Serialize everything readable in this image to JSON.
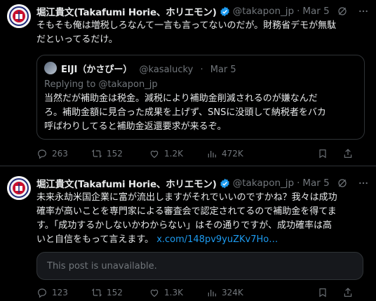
{
  "tweets": [
    {
      "author_name": "堀江貴文(Takafumi Horie、ホリエモン)",
      "handle": "@takapon_jp",
      "date": "Mar 5",
      "text": "そもそも俺は増税しろなんて一言も言ってないのだが。財務省デモが無駄\nだといってるだけ。",
      "quote": {
        "author_name": "EIJI（かさぴー）",
        "handle": "@kasalucky",
        "date": "Mar 5",
        "reply_prefix": "Replying to",
        "reply_to": "@takapon_jp",
        "text": "当然だが補助金は税金。減税により補助金削減されるのが嫌なんだ\nろ。補助金額に見合った成果を上げず、SNSに没頭して納税者をバカ\n呼ばわりしてると補助金返還要求が来るぞ。"
      },
      "stats": {
        "replies": "263",
        "reposts": "152",
        "likes": "1.2K",
        "views": "472K"
      }
    },
    {
      "author_name": "堀江貴文(Takafumi Horie、ホリエモン)",
      "handle": "@takapon_jp",
      "date": "Mar 5",
      "text": "未来永劫米国企業に富が流出しますがそれでいいのですかね？我々は成功\n確率が高いことを専門家による審査会で認定されてるので補助金を得てま\nす。「成功するかしないかわからない」はその通りですが、成功確率は高\nいと自信をもって言えます。 ",
      "link": "x.com/148pv9yuZKv7Ho…",
      "unavailable_notice": "This post is unavailable.",
      "stats": {
        "replies": "123",
        "reposts": "152",
        "likes": "1.3K",
        "views": "324K"
      }
    }
  ],
  "colors": {
    "accent": "#1d9bf0",
    "muted": "#71767b",
    "text": "#e7e9ea",
    "border": "#2f3336"
  },
  "icons": [
    "verified-badge-icon",
    "grok-icon",
    "more-icon",
    "reply-icon",
    "repost-icon",
    "like-icon",
    "views-icon",
    "bookmark-icon",
    "share-icon"
  ]
}
